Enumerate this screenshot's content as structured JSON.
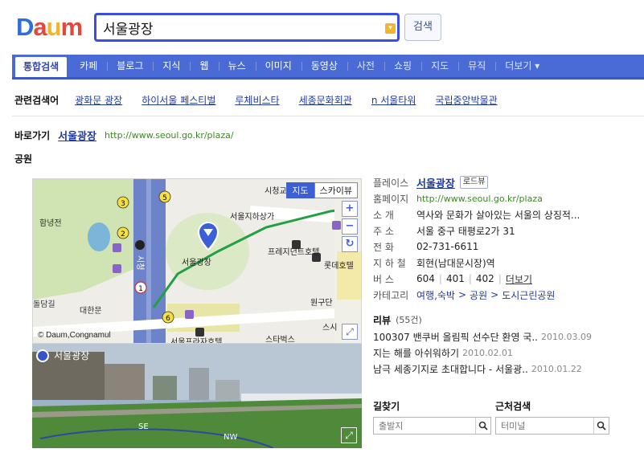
{
  "header": {
    "logo": [
      "D",
      "a",
      "u",
      "m"
    ],
    "logo_colors": [
      "#2e6cdf",
      "#e5473a",
      "#f2b52a",
      "#e5473a"
    ],
    "search": {
      "value": "서울광장"
    },
    "search_button": "검색"
  },
  "nav": {
    "items": [
      "통합검색",
      "카페",
      "블로그",
      "지식",
      "웹",
      "뉴스",
      "이미지",
      "동영상",
      "사전",
      "쇼핑",
      "지도",
      "뮤직",
      "더보기 ▾"
    ],
    "active_index": 0
  },
  "related": {
    "label": "관련검색어",
    "links": [
      "광화문 광장",
      "하이서울 페스티벌",
      "루체비스타",
      "세종문화회관",
      "n 서울타워",
      "국립중앙박물관"
    ]
  },
  "shortcut": {
    "label": "바로가기",
    "title": "서울광장",
    "url": "http://www.seoul.go.kr/plaza/"
  },
  "category": "공원",
  "map": {
    "labels": {
      "hamnyeong": "함녕전",
      "metro": "서울지하상가",
      "cityhall": "시청교",
      "plaza": "서울광장",
      "prezident": "프레지던트호텔",
      "lotte": "롯데호텔",
      "wongudan": "원구단",
      "sigyo": "시청",
      "deoksu": "돌담길",
      "daehanmun": "대한문",
      "plazahotel": "서울프라자호텔",
      "starbucks": "스타벅스",
      "seosi": "스시"
    },
    "route_numbers": [
      "3",
      "2",
      "5",
      "6",
      "1"
    ],
    "toggle": [
      "지도",
      "스카이뷰"
    ],
    "zoom": [
      "+",
      "−"
    ],
    "credit": "© Daum,Congnamul"
  },
  "roadview": {
    "label": "서울광장",
    "compass": [
      "SE",
      "NW"
    ]
  },
  "info": {
    "place_label": "플레이스",
    "place_name": "서울광장",
    "roadview_badge": "로드뷰",
    "rows": [
      {
        "key": "홈페이지",
        "value": "http://www.seoul.go.kr/plaza",
        "type": "url"
      },
      {
        "key": "소      개",
        "value": "역사와 문화가 살아있는 서울의 상징적...",
        "type": "text"
      },
      {
        "key": "주      소",
        "value": "서울 중구 태평로2가 31",
        "type": "text"
      },
      {
        "key": "전      화",
        "value": "02-731-6611",
        "type": "text"
      },
      {
        "key": "지 하 철",
        "value": "회현(남대문시장)역",
        "type": "text"
      }
    ],
    "bus_key": "버      스",
    "bus": [
      "604",
      "401",
      "402"
    ],
    "bus_more": "더보기",
    "category_key": "카테고리",
    "category": [
      "여행,숙박",
      "공원",
      "도시근린공원"
    ],
    "review_title": "리뷰",
    "review_count": "(55건)",
    "reviews": [
      {
        "text": "100307 밴쿠버 올림픽 선수단 환영 국..",
        "date": "2010.03.09"
      },
      {
        "text": "지는 해를 아쉬워하기",
        "date": "2010.02.01"
      },
      {
        "text": "남극 세종기지로 초대합니다 - 서울광..",
        "date": "2010.01.22"
      }
    ]
  },
  "bottom": {
    "route_title": "길찾기",
    "route_placeholder": "출발지",
    "near_title": "근처검색",
    "near_placeholder": "터미널"
  }
}
